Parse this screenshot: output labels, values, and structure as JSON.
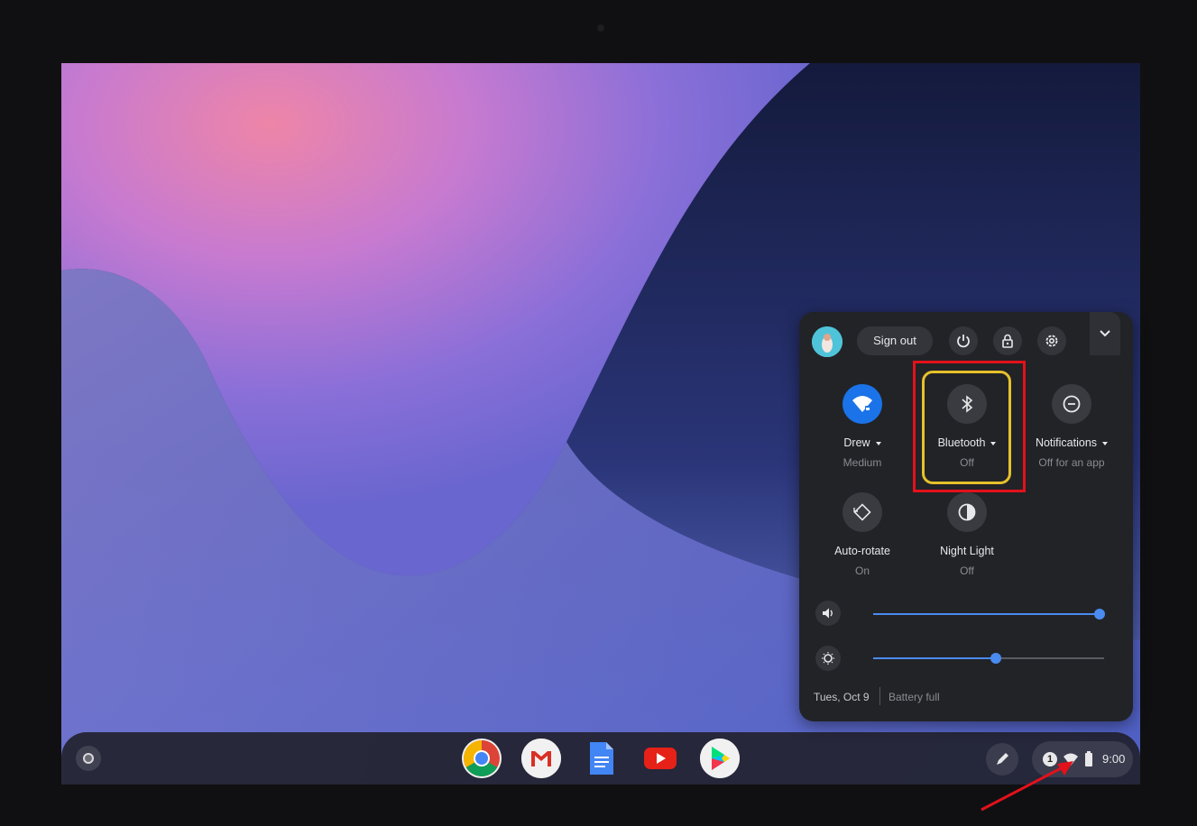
{
  "quick_settings": {
    "sign_out_label": "Sign out",
    "tiles": [
      {
        "label": "Drew",
        "sub": "Medium",
        "icon": "wifi-icon",
        "active": true
      },
      {
        "label": "Bluetooth",
        "sub": "Off",
        "icon": "bluetooth-icon",
        "active": false
      },
      {
        "label": "Notifications",
        "sub": "Off for an app",
        "icon": "do-not-disturb-icon",
        "active": false
      },
      {
        "label": "Auto-rotate",
        "sub": "On",
        "icon": "auto-rotate-icon",
        "active": false
      },
      {
        "label": "Night Light",
        "sub": "Off",
        "icon": "night-light-icon",
        "active": false
      }
    ],
    "volume_level": 0.98,
    "brightness_level": 0.53,
    "date": "Tues, Oct 9",
    "battery_status": "Battery full"
  },
  "shelf": {
    "apps": [
      "chrome-icon",
      "gmail-icon",
      "docs-icon",
      "youtube-icon",
      "play-store-icon"
    ],
    "tray_badge": "1",
    "time": "9:00"
  },
  "colors": {
    "accent": "#1a73e8",
    "annotation_red": "#e3111b",
    "annotation_yellow": "#e6c12b"
  }
}
